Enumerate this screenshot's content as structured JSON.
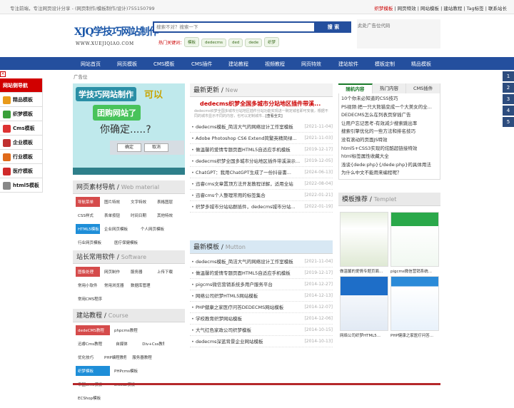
{
  "topbar": {
    "left": "专注前端，专注网页设计分享 - (网页制作/模板制作/设计)755150799",
    "right_links": [
      "织梦模板",
      "网页特效",
      "网站模板",
      "建站教程",
      "Tag标签",
      "联系站长"
    ]
  },
  "logo": {
    "text": "XJQ学技巧网站制作",
    "url": "WWW.XUEJIQIAO.COM"
  },
  "search": {
    "placeholder": "搜索不对？搜索一下",
    "button": "搜 索",
    "hot_label": "热门关键词：",
    "hot_tags": [
      "模板",
      "dedecms",
      "ded",
      "dede",
      "织梦"
    ]
  },
  "ad_top": "此处广告位代码",
  "nav": [
    "网站首页",
    "网页模板",
    "CMS模板",
    "CMS插件",
    "建站教程",
    "视频教程",
    "网页特效",
    "建站软件",
    "模板定制",
    "精品模板"
  ],
  "ad_label": "广告位",
  "sidebar": {
    "items": [
      "网站侧导航",
      "精品模板",
      "织梦模板",
      "Cms模板",
      "企业模板",
      "行业模板",
      "医疗模板",
      "html5模板"
    ]
  },
  "right_nums": [
    "1",
    "2",
    "3",
    "4",
    "5"
  ],
  "banner": {
    "t1": "学技巧网站制作",
    "t2": "可以",
    "t3": "团购网站了",
    "t4": "你确定.....?",
    "ok": "确定",
    "cancel": "取消"
  },
  "material": {
    "title": "网页素材导航",
    "en": "Web material",
    "tags": [
      "导航菜单",
      "图片特效",
      "文字特效",
      "表格图层",
      "CSS样式",
      "表单按钮",
      "时间日期",
      "其他特效",
      "HTML5模板",
      "企业网页模板",
      "个人网页模板",
      "行业网页模板",
      "医疗保健模板"
    ]
  },
  "software": {
    "title": "站长常用软件",
    "en": "Software",
    "tags": [
      "图像处理",
      "网页制作",
      "服务器",
      "上传下载",
      "常用小软件",
      "常用浏览器",
      "数据库管理",
      "常用CMS程序"
    ]
  },
  "course": {
    "title": "建站教程",
    "en": "Course",
    "tags": [
      "dedeCMS教程",
      "phpcms教程",
      "迅睿Cms教程",
      "自媒体",
      "Div+Css教程",
      "优化技巧",
      "PHP编程教程",
      "服务器教程",
      "织梦模板",
      "PHPcms模板",
      "帝国Cms模板",
      "Discuz模板",
      "ECShop模板"
    ]
  },
  "latest": {
    "title": "最新更新",
    "en": "New",
    "headline": "dedecms织梦全国多城市分站地区插件带溪...",
    "desc": "dedecms织梦全国多城市分站地区插件分站功能实现进一碗定城名即可安装，根据不同的城市显示不同的内容，也可以定制城市...",
    "more": "[查看全文]",
    "items": [
      {
        "t": "dedecms模板_简洁大气的网络设计工作室模板",
        "d": "[2021-11-04]"
      },
      {
        "t": "Adobe Photoshop CS6 Extend简繁英精简绿...",
        "d": "[2021-11-03]"
      },
      {
        "t": "做温馨的爱情专题页面HTML5自适应手机模板",
        "d": "[2019-12-17]"
      },
      {
        "t": "dedecms织梦全国多城市分站地区插件带溪演示...",
        "d": "[2019-12-05]"
      },
      {
        "t": "ChatGPT：我用ChatGPT生成了一份抖音書...",
        "d": "[2024-06-13]"
      },
      {
        "t": "迅睿cms文章置顶方法开发教程详解，适用全站",
        "d": "[2022-08-04]"
      },
      {
        "t": "迅睿cms个人整理常用的标签集合",
        "d": "[2022-01-21]"
      },
      {
        "t": "织梦多城市分站站群插件，dedecms城市分站...",
        "d": "[2022-01-19]"
      }
    ]
  },
  "newtmpl": {
    "title": "最新模板",
    "en": "Mutton",
    "items": [
      {
        "t": "dedecms模板_简洁大气的网络设计工作室模板",
        "d": "[2021-11-04]"
      },
      {
        "t": "做温馨的爱情专题页面HTML5自适应手机模板",
        "d": "[2019-12-17]"
      },
      {
        "t": "pigcms微信营销系统多用户服务平台",
        "d": "[2014-12-27]"
      },
      {
        "t": "网络公司织梦HTML5网站模板",
        "d": "[2014-12-13]"
      },
      {
        "t": "PHP健康之家医疗问答DEDECMS网站模板",
        "d": "[2014-12-07]"
      },
      {
        "t": "学校教育织梦网站模板",
        "d": "[2014-12-06]"
      },
      {
        "t": "大气红色家政公司织梦模板",
        "d": "[2014-10-15]"
      },
      {
        "t": "dedecms深蓝背景企业网站模板",
        "d": "[2014-10-13]"
      }
    ]
  },
  "tabs": {
    "labels": [
      "随机内容",
      "热门内容",
      "CMS插件"
    ],
    "items": [
      "10个你未必知道的CSS技巧",
      "PS视频:把一只大熊猫变成一个大美女的全...",
      "DEDECMS怎么在列表页穿插广告",
      "让用户忘记思考-有效减少搜索跳出率",
      "搜索引擎优化的一些方法和排名技巧",
      "没有滚动的页面JS特效",
      "html5+CSS3实现的炫酷超链接特效",
      "html标签属性收藏大全",
      "浅谈{dede:php}{/dede:php}的具体用法",
      "为什么中文不能用来编程呢？"
    ]
  },
  "templet": {
    "title": "模板推荐",
    "en": "Templet",
    "items": [
      "做温馨的爱情专题页面...",
      "pigcms微信营销系统...",
      "网络公司织梦HTML5...",
      "PHP健康之家医疗问答..."
    ]
  }
}
